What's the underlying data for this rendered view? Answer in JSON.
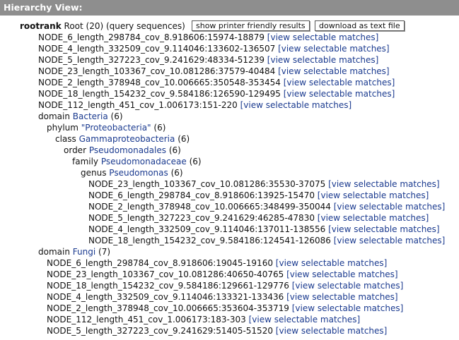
{
  "header": {
    "title": "Hierarchy View:"
  },
  "root": {
    "rank": "rootrank",
    "label": "Root (20) (query sequences)",
    "printer_button": "show printer friendly results",
    "download_button": "download as text file",
    "nodes": [
      {
        "id": "NODE_6_length_298784_cov_8.918606:15974-18879",
        "link": "[view selectable matches]"
      },
      {
        "id": "NODE_4_length_332509_cov_9.114046:133602-136507",
        "link": "[view selectable matches]"
      },
      {
        "id": "NODE_5_length_327223_cov_9.241629:48334-51239",
        "link": "[view selectable matches]"
      },
      {
        "id": "NODE_23_length_103367_cov_10.081286:37579-40484",
        "link": "[view selectable matches]"
      },
      {
        "id": "NODE_2_length_378948_cov_10.006665:350548-353454",
        "link": "[view selectable matches]"
      },
      {
        "id": "NODE_18_length_154232_cov_9.584186:126590-129495",
        "link": "[view selectable matches]"
      },
      {
        "id": "NODE_112_length_451_cov_1.006173:151-220",
        "link": "[view selectable matches]"
      }
    ]
  },
  "bacteria": {
    "domain": {
      "rank": "domain",
      "name": "Bacteria",
      "count": "(6)"
    },
    "phylum": {
      "rank": "phylum",
      "name": "\"Proteobacteria\"",
      "count": "(6)"
    },
    "class": {
      "rank": "class",
      "name": "Gammaproteobacteria",
      "count": "(6)"
    },
    "order": {
      "rank": "order",
      "name": "Pseudomonadales",
      "count": "(6)"
    },
    "family": {
      "rank": "family",
      "name": "Pseudomonadaceae",
      "count": "(6)"
    },
    "genus": {
      "rank": "genus",
      "name": "Pseudomonas",
      "count": "(6)"
    },
    "nodes": [
      {
        "id": "NODE_23_length_103367_cov_10.081286:35530-37075",
        "link": "[view selectable matches]"
      },
      {
        "id": "NODE_6_length_298784_cov_8.918606:13925-15470",
        "link": "[view selectable matches]"
      },
      {
        "id": "NODE_2_length_378948_cov_10.006665:348499-350044",
        "link": "[view selectable matches]"
      },
      {
        "id": "NODE_5_length_327223_cov_9.241629:46285-47830",
        "link": "[view selectable matches]"
      },
      {
        "id": "NODE_4_length_332509_cov_9.114046:137011-138556",
        "link": "[view selectable matches]"
      },
      {
        "id": "NODE_18_length_154232_cov_9.584186:124541-126086",
        "link": "[view selectable matches]"
      }
    ]
  },
  "fungi": {
    "domain": {
      "rank": "domain",
      "name": "Fungi",
      "count": "(7)"
    },
    "nodes": [
      {
        "id": "NODE_6_length_298784_cov_8.918606:19045-19160",
        "link": "[view selectable matches]"
      },
      {
        "id": "NODE_23_length_103367_cov_10.081286:40650-40765",
        "link": "[view selectable matches]"
      },
      {
        "id": "NODE_18_length_154232_cov_9.584186:129661-129776",
        "link": "[view selectable matches]"
      },
      {
        "id": "NODE_4_length_332509_cov_9.114046:133321-133436",
        "link": "[view selectable matches]"
      },
      {
        "id": "NODE_2_length_378948_cov_10.006665:353604-353719",
        "link": "[view selectable matches]"
      },
      {
        "id": "NODE_112_length_451_cov_1.006173:183-303",
        "link": "[view selectable matches]"
      },
      {
        "id": "NODE_5_length_327223_cov_9.241629:51405-51520",
        "link": "[view selectable matches]"
      }
    ]
  }
}
